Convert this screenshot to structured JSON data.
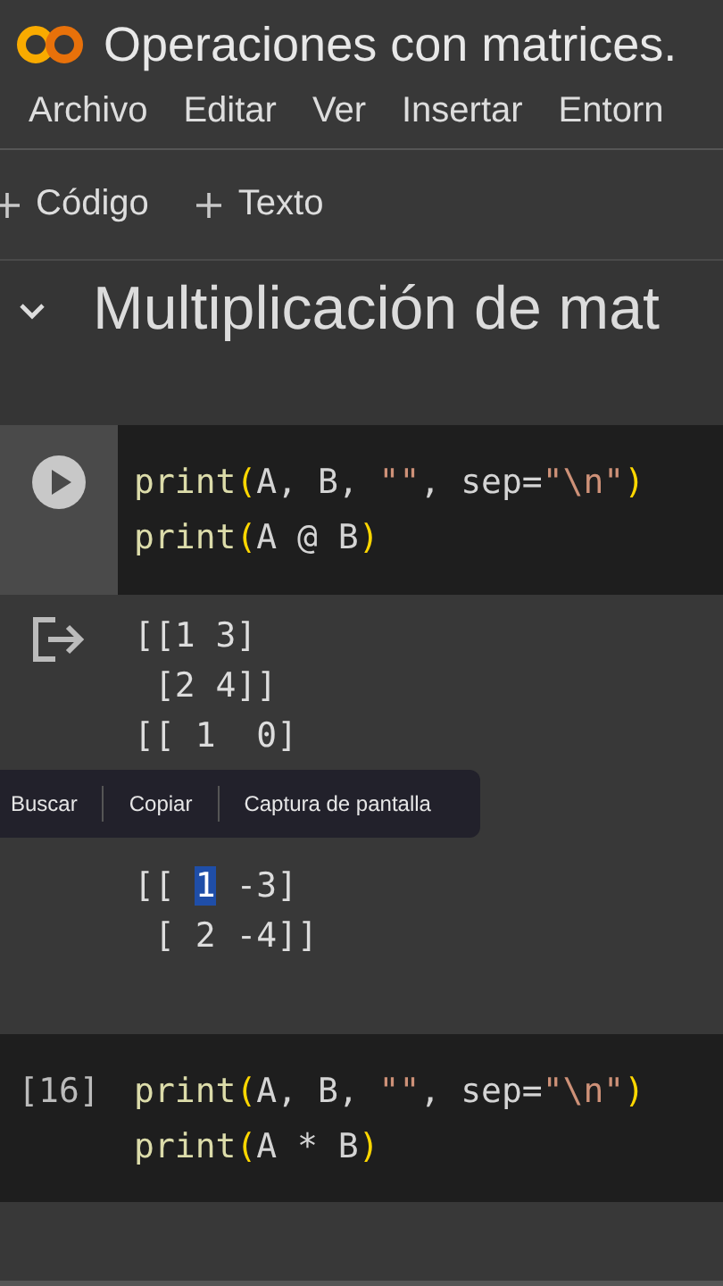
{
  "header": {
    "title": "Operaciones con matrices.",
    "menu": [
      "Archivo",
      "Editar",
      "Ver",
      "Insertar",
      "Entorn"
    ]
  },
  "toolbar": [
    "Código",
    "Texto"
  ],
  "section": {
    "heading": "Multiplicación de mat",
    "expanded": true
  },
  "cells": [
    {
      "kind": "play",
      "lines": [
        [
          {
            "text": "print",
            "kind": "function"
          },
          {
            "text": "(",
            "kind": "paren"
          },
          {
            "text": "A, B, ",
            "kind": "plain"
          },
          {
            "text": "\"\"",
            "kind": "string"
          },
          {
            "text": ", sep=",
            "kind": "plain"
          },
          {
            "text": "\"\\n\"",
            "kind": "string"
          },
          {
            "text": ")",
            "kind": "paren"
          }
        ],
        [
          {
            "text": "print",
            "kind": "function"
          },
          {
            "text": "(",
            "kind": "paren"
          },
          {
            "text": "A @ B",
            "kind": "plain"
          },
          {
            "text": ")",
            "kind": "paren"
          }
        ]
      ],
      "output": {
        "lines_above": [
          "[[1 3]",
          " [2 4]]",
          "[[ 1  0]"
        ],
        "context_menu": [
          "Buscar",
          "Copiar",
          "Captura de pantalla"
        ],
        "lines_below": [
          [
            {
              "text": "[[ ",
              "selected": false
            },
            {
              "text": "1",
              "selected": true
            },
            {
              "text": " -3]",
              "selected": false
            }
          ],
          [
            {
              "text": " [ 2 -4]]",
              "selected": false
            }
          ]
        ]
      }
    },
    {
      "kind": "count",
      "count": "[16]",
      "lines": [
        [
          {
            "text": "print",
            "kind": "function"
          },
          {
            "text": "(",
            "kind": "paren"
          },
          {
            "text": "A, B, ",
            "kind": "plain"
          },
          {
            "text": "\"\"",
            "kind": "string"
          },
          {
            "text": ", sep=",
            "kind": "plain"
          },
          {
            "text": "\"\\n\"",
            "kind": "string"
          },
          {
            "text": ")",
            "kind": "paren"
          }
        ],
        [
          {
            "text": "print",
            "kind": "function"
          },
          {
            "text": "(",
            "kind": "paren"
          },
          {
            "text": "A * B",
            "kind": "plain"
          },
          {
            "text": ")",
            "kind": "paren"
          }
        ]
      ]
    }
  ]
}
